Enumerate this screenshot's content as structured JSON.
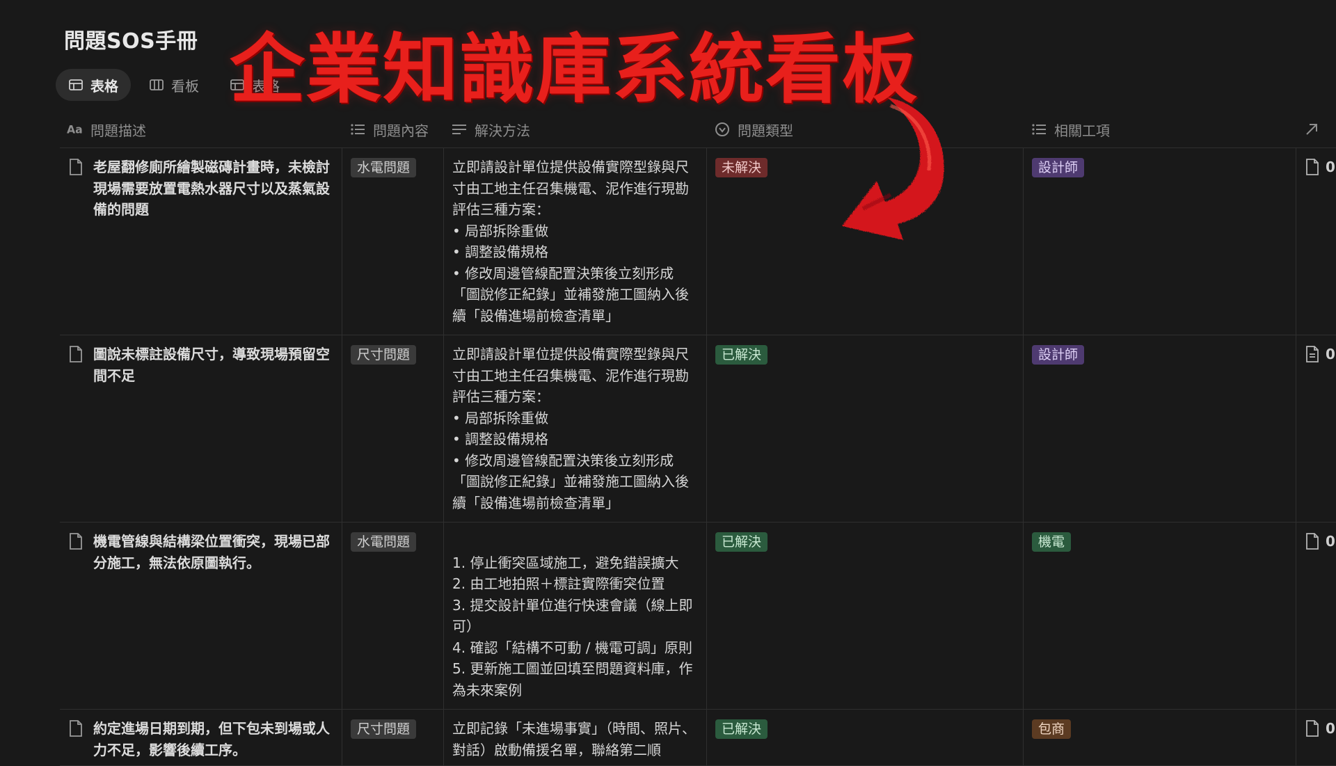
{
  "page": {
    "title": "問題SOS手冊"
  },
  "tabs": [
    {
      "label": "表格",
      "icon": "table-icon",
      "active": true
    },
    {
      "label": "看板",
      "icon": "board-icon"
    },
    {
      "label": "表格",
      "icon": "table-icon"
    }
  ],
  "overlay": {
    "title": "企業知識庫系統看板",
    "arrow_icon": "red-curved-arrow-icon",
    "color": "#e8201c"
  },
  "columns": [
    {
      "label": "問題描述",
      "icon": "aa-text-icon"
    },
    {
      "label": "問題內容",
      "icon": "list-icon"
    },
    {
      "label": "解決方法",
      "icon": "text-lines-icon"
    },
    {
      "label": "問題類型",
      "icon": "status-icon"
    },
    {
      "label": "相關工項",
      "icon": "list-icon"
    },
    {
      "label": "",
      "icon": "arrow-up-right-icon"
    }
  ],
  "rows": [
    {
      "description": "老屋翻修廁所繪製磁磚計畫時，未檢討現場需要放置電熱水器尺寸以及蒸氣設備的問題",
      "content": "水電問題",
      "solution": "立即請設計單位提供設備實際型錄與尺寸由工地主任召集機電、泥作進行現勘評估三種方案：\n• 局部拆除重做\n• 調整設備規格\n• 修改周邊管線配置決策後立刻形成「圖說修正紀錄」並補發施工圖納入後續「設備進場前檢查清單」",
      "status": "未解決",
      "trade": "設計師",
      "last": "0"
    },
    {
      "description": "圖說未標註設備尺寸，導致現場預留空間不足",
      "content": "尺寸問題",
      "solution": "立即請設計單位提供設備實際型錄與尺寸由工地主任召集機電、泥作進行現勘評估三種方案：\n• 局部拆除重做\n• 調整設備規格\n• 修改周邊管線配置決策後立刻形成「圖說修正紀錄」並補發施工圖納入後續「設備進場前檢查清單」",
      "status": "已解決",
      "trade": "設計師",
      "last": "0"
    },
    {
      "description": "機電管線與結構梁位置衝突，現場已部分施工，無法依原圖執行。",
      "content": "水電問題",
      "solution": "\n1. 停止衝突區域施工，避免錯誤擴大\n2. 由工地拍照＋標註實際衝突位置\n3. 提交設計單位進行快速會議（線上即可）\n4. 確認「結構不可動 / 機電可調」原則\n5. 更新施工圖並回填至問題資料庫，作為未來案例",
      "status": "已解決",
      "trade": "機電",
      "last": "0"
    },
    {
      "description": "約定進場日期到期，但下包未到場或人力不足，影響後續工序。",
      "content": "尺寸問題",
      "solution": "立即記錄「未進場事實」（時間、照片、對話）啟動備援名單，聯絡第二順",
      "status": "已解決",
      "trade": "包商",
      "last": "0"
    }
  ]
}
